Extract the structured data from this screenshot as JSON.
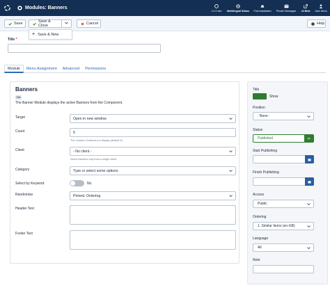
{
  "header": {
    "title": "Modules: Banners",
    "items": [
      {
        "label": "4.2.0 dev",
        "icon": "joomla-icon"
      },
      {
        "label": "Multilingual Status",
        "icon": "language-icon"
      },
      {
        "label": "Post-installation",
        "icon": "bell-icon"
      },
      {
        "label": "Private Messages",
        "icon": "envelope-icon"
      },
      {
        "label": "J4 Beta",
        "icon": "external-link-icon"
      },
      {
        "label": "User Menu",
        "icon": "user-icon"
      }
    ]
  },
  "toolbar": {
    "save": "Save",
    "save_close": "Save & Close",
    "cancel": "Cancel",
    "help": "Help",
    "save_new": "Save & New"
  },
  "title_field": {
    "label": "Title",
    "required_mark": "*",
    "value": ""
  },
  "tabs": [
    "Module",
    "Menu Assignment",
    "Advanced",
    "Permissions"
  ],
  "module": {
    "heading": "Banners",
    "badge": "Site",
    "description": "The Banner Module displays the active Banners from the Component.",
    "fields": {
      "target": {
        "label": "Target",
        "value": "Open in new window"
      },
      "count": {
        "label": "Count",
        "value": "5",
        "hint": "The number of banners to display (default 5)."
      },
      "client": {
        "label": "Client",
        "value": "- No client -",
        "hint": "Select banners only from a single client."
      },
      "category": {
        "label": "Category",
        "value": "Type or select some options"
      },
      "keyword": {
        "label": "Select by Keyword",
        "value": "No"
      },
      "randomise": {
        "label": "Randomise",
        "value": "Pinned, Ordering"
      },
      "header_text": {
        "label": "Header Text"
      },
      "footer_text": {
        "label": "Footer Text"
      }
    }
  },
  "sidebar": {
    "title": {
      "label": "Title",
      "value": "Show"
    },
    "position": {
      "label": "Position",
      "value": ": None :"
    },
    "status": {
      "label": "Status",
      "value": "Published"
    },
    "start_publishing": {
      "label": "Start Publishing"
    },
    "finish_publishing": {
      "label": "Finish Publishing"
    },
    "access": {
      "label": "Access",
      "value": "Public"
    },
    "ordering": {
      "label": "Ordering",
      "value": "1. Similar Items (en-GB)"
    },
    "language": {
      "label": "Language",
      "value": "All"
    },
    "note": {
      "label": "Note"
    }
  },
  "colors": {
    "header_bg": "#132f53",
    "primary_link": "#2a69b8",
    "published_green": "#2e7d32",
    "calendar_button": "#2a5ea4",
    "required": "#c52827"
  }
}
